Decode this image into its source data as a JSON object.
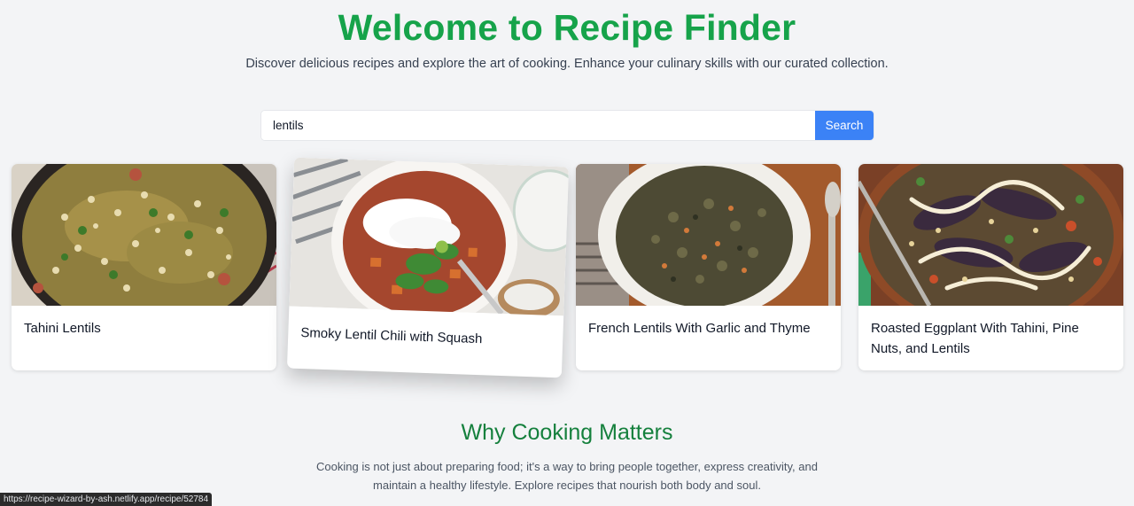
{
  "hero": {
    "title": "Welcome to Recipe Finder",
    "subtitle": "Discover delicious recipes and explore the art of cooking. Enhance your culinary skills with our curated collection."
  },
  "search": {
    "value": "lentils",
    "button_label": "Search"
  },
  "recipes": [
    {
      "title": "Tahini Lentils"
    },
    {
      "title": "Smoky Lentil Chili with Squash"
    },
    {
      "title": "French Lentils With Garlic and Thyme"
    },
    {
      "title": "Roasted Eggplant With Tahini, Pine Nuts, and Lentils"
    }
  ],
  "about": {
    "title": "Why Cooking Matters",
    "text": "Cooking is not just about preparing food; it's a way to bring people together, express creativity, and maintain a healthy lifestyle. Explore recipes that nourish both body and soul."
  },
  "status_bar": {
    "url": "https://recipe-wizard-by-ash.netlify.app/recipe/52784"
  },
  "colors": {
    "accent_green": "#16a34a",
    "section_green": "#15803d",
    "button_blue": "#3b82f6"
  }
}
